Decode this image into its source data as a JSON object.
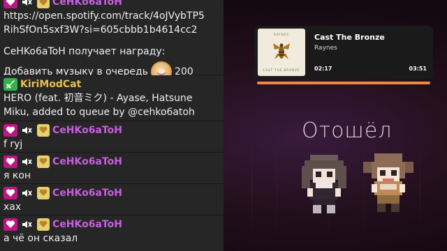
{
  "chat": {
    "top_name": "CeHKo6aToH",
    "link_line1": "https://open.spotify.com/track/4oJVybTP5",
    "link_line2": "RihSfOn5sxf3W?si=605cbbb1b4614cc2",
    "reward_text": "CeHKo6aToH получает награду:",
    "reward_item": "Добавить музыку в очередь",
    "reward_cost": "200",
    "mod_name": "KiriModCat",
    "mod_line1": "HERO (feat. 初音ミク) - Ayase, Hatsune",
    "mod_line2": "Miku, added to queue by @cehko6atoh",
    "messages": [
      {
        "name": "CeHKo6aToH",
        "text": "f ryj"
      },
      {
        "name": "CeHKo6aToH",
        "text": "я кон"
      },
      {
        "name": "CeHKo6aToH",
        "text": "хах"
      },
      {
        "name": "CeHKo6aToH",
        "text": "а чё он сказал"
      }
    ]
  },
  "now_playing": {
    "title": "Cast The Bronze",
    "artist": "Raynes",
    "elapsed": "02:17",
    "duration": "03:51",
    "progress": 1.0,
    "cover_top": "RAYNES",
    "cover_bottom": "CAST THE BRONZE"
  },
  "status_text": "Отошёл",
  "colors": {
    "username": "#c85ee0",
    "mod_username": "#e8c14a",
    "progress": "#ef8a3b",
    "chat_bg": "#262626"
  }
}
